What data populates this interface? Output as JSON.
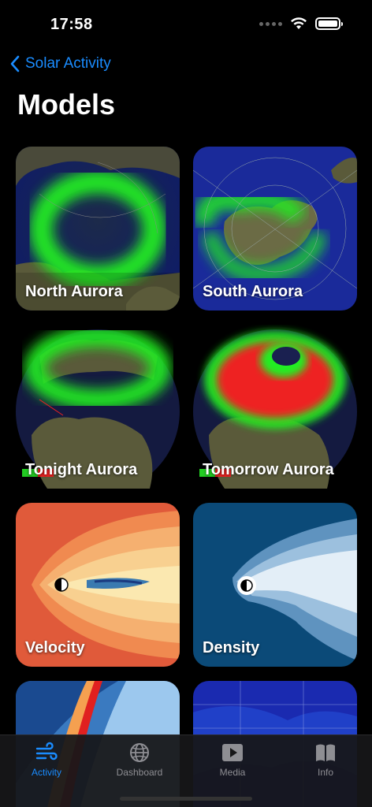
{
  "status": {
    "time": "17:58"
  },
  "nav": {
    "back_label": "Solar Activity",
    "title": "Models"
  },
  "models": [
    {
      "label": "North Aurora"
    },
    {
      "label": "South Aurora"
    },
    {
      "label": "Tonight Aurora"
    },
    {
      "label": "Tomorrow Aurora"
    },
    {
      "label": "Velocity"
    },
    {
      "label": "Density"
    }
  ],
  "tabs": [
    {
      "label": "Activity",
      "icon": "wind-icon",
      "active": true
    },
    {
      "label": "Dashboard",
      "icon": "globe-icon",
      "active": false
    },
    {
      "label": "Media",
      "icon": "play-icon",
      "active": false
    },
    {
      "label": "Info",
      "icon": "book-icon",
      "active": false
    }
  ],
  "colors": {
    "accent": "#1a8cff",
    "aurora_green": "#22ee22",
    "aurora_red": "#ee2222",
    "map_blue": "#1a2a9a"
  }
}
